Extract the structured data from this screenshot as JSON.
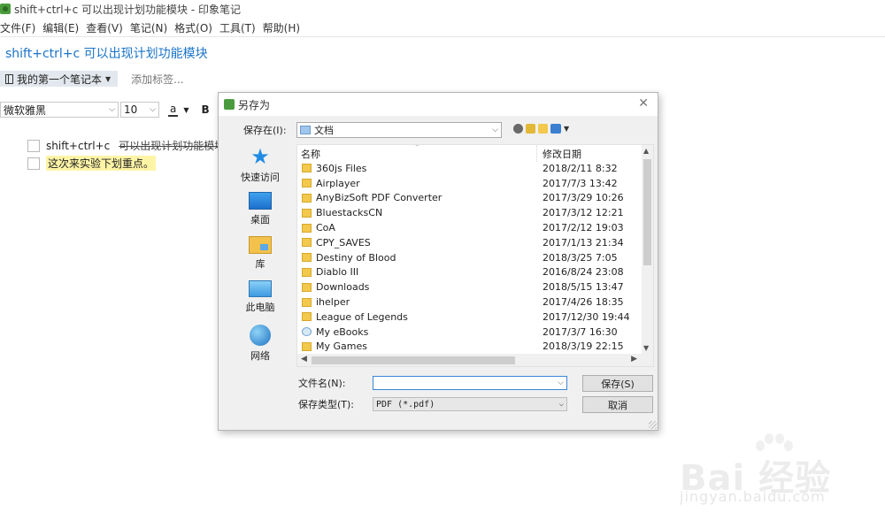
{
  "window": {
    "title": "shift+ctrl+c 可以出现计划功能模块 - 印象笔记"
  },
  "menu": [
    {
      "label": "文件(F)"
    },
    {
      "label": "编辑(E)"
    },
    {
      "label": "查看(V)"
    },
    {
      "label": "笔记(N)"
    },
    {
      "label": "格式(O)"
    },
    {
      "label": "工具(T)"
    },
    {
      "label": "帮助(H)"
    }
  ],
  "note": {
    "title": "shift+ctrl+c 可以出现计划功能模块",
    "notebook": "我的第一个笔记本",
    "add_tag": "添加标签...",
    "font": "微软雅黑",
    "font_size": "10",
    "color_label": "a",
    "bold_label": "B",
    "todos": [
      {
        "prefix": "shift+ctrl+c",
        "text": "可以出现计划功能模块",
        "checked": false
      },
      {
        "text": "这次来实验下划重点。",
        "checked": false
      }
    ]
  },
  "dialog": {
    "title": "另存为",
    "close": "✕",
    "save_in_label": "保存在(I):",
    "save_in_value": "文档",
    "places": [
      {
        "label": "快速访问",
        "icon": "quick-access-icon"
      },
      {
        "label": "桌面",
        "icon": "desktop-icon"
      },
      {
        "label": "库",
        "icon": "libraries-icon"
      },
      {
        "label": "此电脑",
        "icon": "this-pc-icon"
      },
      {
        "label": "网络",
        "icon": "network-icon"
      }
    ],
    "columns": {
      "name": "名称",
      "date": "修改日期"
    },
    "files": [
      {
        "name": "360js Files",
        "date": "2018/2/11 8:32",
        "icon": "folder-icon"
      },
      {
        "name": "Airplayer",
        "date": "2017/7/3 13:42",
        "icon": "folder-icon"
      },
      {
        "name": "AnyBizSoft PDF Converter",
        "date": "2017/3/29 10:26",
        "icon": "folder-icon"
      },
      {
        "name": "BluestacksCN",
        "date": "2017/3/12 12:21",
        "icon": "folder-icon"
      },
      {
        "name": "CoA",
        "date": "2017/2/12 19:03",
        "icon": "folder-icon"
      },
      {
        "name": "CPY_SAVES",
        "date": "2017/1/13 21:34",
        "icon": "folder-icon"
      },
      {
        "name": "Destiny of Blood",
        "date": "2018/3/25 7:05",
        "icon": "folder-icon"
      },
      {
        "name": "Diablo III",
        "date": "2016/8/24 23:08",
        "icon": "folder-icon"
      },
      {
        "name": "Downloads",
        "date": "2018/5/15 13:47",
        "icon": "folder-icon"
      },
      {
        "name": "ihelper",
        "date": "2017/4/26 18:35",
        "icon": "folder-icon"
      },
      {
        "name": "League of Legends",
        "date": "2017/12/30 19:44",
        "icon": "folder-icon"
      },
      {
        "name": "My eBooks",
        "date": "2017/3/7 16:30",
        "icon": "ebook-folder-icon"
      },
      {
        "name": "My Games",
        "date": "2018/3/19 22:15",
        "icon": "folder-icon"
      }
    ],
    "filename_label": "文件名(N):",
    "filename_value": "",
    "filetype_label": "保存类型(T):",
    "filetype_value": "PDF (*.pdf)",
    "save_button": "保存(S)",
    "cancel_button": "取消"
  },
  "watermark": {
    "main": "Bai 经验",
    "sub": "jingyan.baidu.com"
  },
  "colors": {
    "title_blue": "#1a74c9",
    "highlight": "#fdf4a6",
    "evernote_green": "#4a9b3d"
  }
}
